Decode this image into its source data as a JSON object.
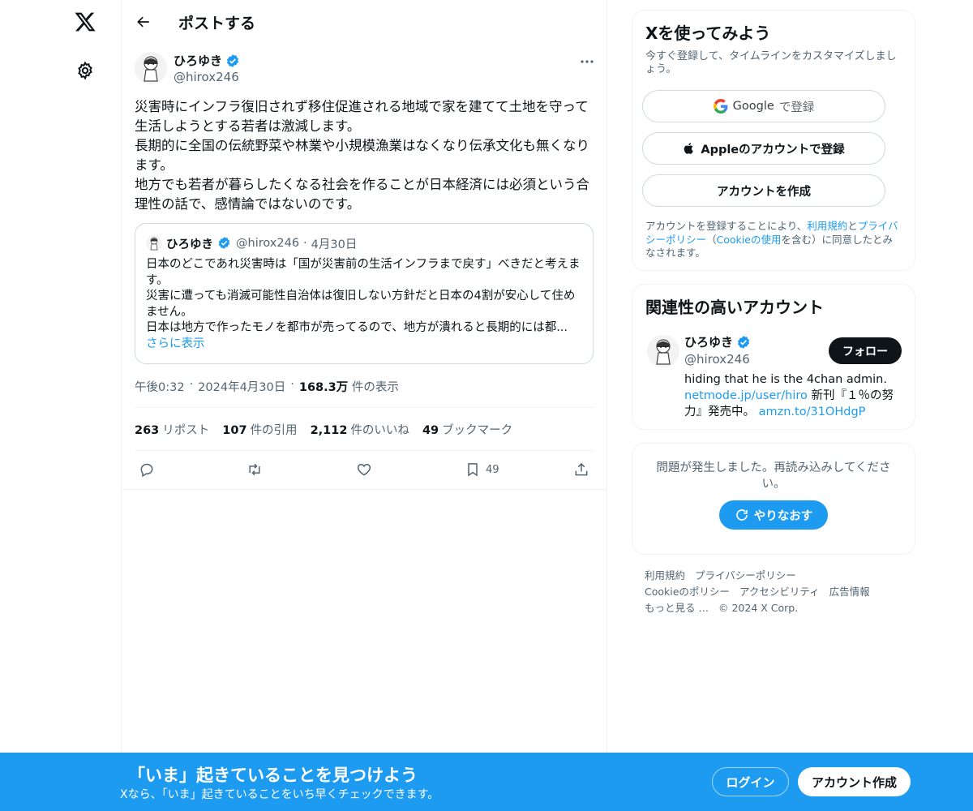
{
  "topbar": {
    "title": "ポストする"
  },
  "post": {
    "author_name": "ひろゆき",
    "author_handle": "@hirox246",
    "text": "災害時にインフラ復旧されず移住促進される地域で家を建てて土地を守って生活しようとする若者は激減します。\n長期的に全国の伝統野菜や林業や小規模漁業はなくなり伝承文化も無くなります。\n地方でも若者が暮らしたくなる社会を作ることが日本経済には必須という合理性の話で、感情論ではないのです。",
    "time": "午後0:32",
    "date": "2024年4月30日",
    "views_number": "168.3万",
    "views_label": "件の表示",
    "stats": {
      "reposts_number": "263",
      "reposts_label": "リポスト",
      "quotes_number": "107",
      "quotes_label": "件の引用",
      "likes_number": "2,112",
      "likes_label": "件のいいね",
      "bookmarks_number": "49",
      "bookmarks_label": "ブックマーク"
    },
    "bookmark_count": "49"
  },
  "quote": {
    "author_name": "ひろゆき",
    "author_handle": "@hirox246",
    "date": "4月30日",
    "text": "日本のどこであれ災害時は「国が災害前の生活インフラまで戻す」べきだと考えます。\n災害に遭っても消滅可能性自治体は復旧しない方針だと日本の4割が安心して住めません。\n日本は地方で作ったモノを都市が売ってるので、地方が潰れると長期的には都...",
    "show_more": "さらに表示"
  },
  "signup_card": {
    "title": "Xを使ってみよう",
    "subtitle": "今すぐ登録して、タイムラインをカスタマイズしましょう。",
    "google_brand": "Google",
    "google_suffix": "で登録",
    "apple_label": "Appleのアカウントで登録",
    "create_label": "アカウントを作成",
    "legal_prefix": "アカウントを登録することにより、",
    "terms": "利用規約",
    "and": "と",
    "privacy": "プライバシーポリシー",
    "paren_open": "（",
    "cookie": "Cookieの使用",
    "legal_suffix": "を含む）に同意したとみなされます。"
  },
  "related": {
    "title": "関連性の高いアカウント",
    "name": "ひろゆき",
    "handle": "@hirox246",
    "follow_label": "フォロー",
    "bio_text": "hiding that he is the 4chan admin.",
    "bio_link1": "netmode.jp/user/hiro",
    "bio_mid": " 新刊『１％の努力』発売中。 ",
    "bio_link2": "amzn.to/31OHdgP"
  },
  "error_card": {
    "message": "問題が発生しました。再読み込みしてください。",
    "retry_label": "やりなおす"
  },
  "footer": {
    "items": [
      "利用規約",
      "プライバシーポリシー",
      "Cookieのポリシー",
      "アクセシビリティ",
      "広告情報",
      "もっと見る …",
      "© 2024 X Corp."
    ]
  },
  "banner": {
    "title": "「いま」起きていることを見つけよう",
    "subtitle": "Xなら、「いま」起きていることをいち早くチェックできます。",
    "login_label": "ログイン",
    "signup_label": "アカウント作成"
  },
  "colors": {
    "accent": "#1d9bf0",
    "text": "#0f1419",
    "muted": "#536471",
    "border": "#eff3f4"
  }
}
